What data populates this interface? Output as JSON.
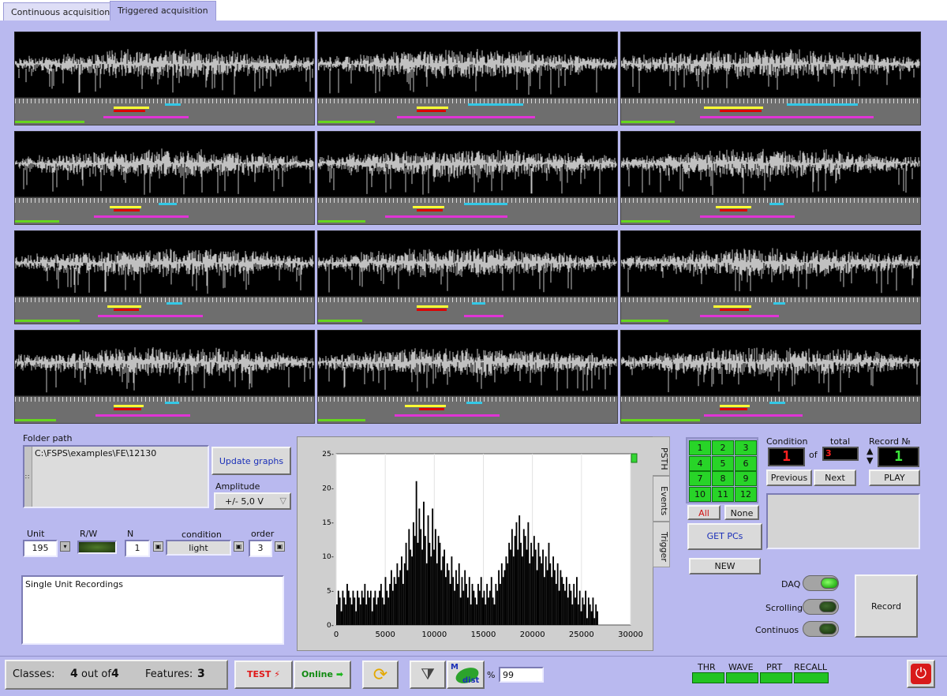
{
  "tabs": [
    {
      "label": "Continuous acquisition",
      "active": false
    },
    {
      "label": "Triggered acquisition",
      "active": true
    }
  ],
  "folder": {
    "label": "Folder path",
    "path": "C:\\FSPS\\examples\\FE\\12130",
    "update_button": "Update graphs"
  },
  "amplitude": {
    "label": "Amplitude",
    "value": "+/- 5,0 V"
  },
  "unit": {
    "label": "Unit",
    "value": "195"
  },
  "rw": {
    "label": "R/W"
  },
  "n": {
    "label": "N",
    "value": "1"
  },
  "condition_field": {
    "label": "condition",
    "value": "light"
  },
  "order": {
    "label": "order",
    "value": "3"
  },
  "notes": {
    "text": "Single Unit Recordings"
  },
  "chart_tabs": [
    "PSTH",
    "Events",
    "Trigger"
  ],
  "chart_data": {
    "type": "bar",
    "xlim": [
      0,
      30000
    ],
    "ylim": [
      0,
      25
    ],
    "xticks": [
      "0",
      "5000",
      "10000",
      "15000",
      "20000",
      "25000",
      "30000"
    ],
    "yticks": [
      "0-",
      "5-",
      "10-",
      "15-",
      "20-",
      "25-"
    ],
    "grid": true,
    "bin_width": 150,
    "values": [
      3,
      5,
      4,
      2,
      5,
      4,
      3,
      6,
      5,
      4,
      3,
      5,
      4,
      2,
      5,
      4,
      3,
      5,
      4,
      6,
      3,
      5,
      4,
      5,
      2,
      4,
      5,
      3,
      4,
      5,
      6,
      4,
      3,
      7,
      5,
      4,
      6,
      8,
      5,
      7,
      6,
      9,
      7,
      8,
      10,
      6,
      9,
      12,
      8,
      14,
      11,
      10,
      15,
      13,
      21,
      12,
      17,
      14,
      11,
      18,
      13,
      9,
      16,
      12,
      10,
      17,
      11,
      14,
      9,
      13,
      12,
      8,
      10,
      11,
      7,
      9,
      8,
      6,
      10,
      7,
      5,
      8,
      6,
      9,
      4,
      7,
      5,
      8,
      6,
      4,
      7,
      3,
      6,
      5,
      4,
      3,
      6,
      5,
      7,
      4,
      5,
      3,
      6,
      4,
      5,
      7,
      4,
      3,
      6,
      5,
      8,
      6,
      9,
      7,
      8,
      10,
      9,
      12,
      11,
      14,
      10,
      13,
      15,
      11,
      16,
      12,
      10,
      14,
      13,
      11,
      15,
      9,
      12,
      10,
      13,
      11,
      8,
      12,
      10,
      9,
      11,
      7,
      10,
      8,
      12,
      9,
      7,
      10,
      8,
      6,
      9,
      5,
      8,
      7,
      6,
      5,
      7,
      4,
      6,
      5,
      3,
      6,
      4,
      7,
      3,
      5,
      2,
      4,
      3,
      5,
      1,
      4,
      3,
      2,
      4,
      1,
      3,
      2
    ]
  },
  "keypad": {
    "keys": [
      "1",
      "2",
      "3",
      "4",
      "5",
      "6",
      "7",
      "8",
      "9",
      "10",
      "11",
      "12"
    ],
    "all": "All",
    "none": "None"
  },
  "get_pcs": "GET PCs",
  "new_button": "NEW",
  "condition_panel": {
    "label": "Condition",
    "total_label": "total",
    "value": "1",
    "of": "of",
    "total": "3",
    "previous": "Previous",
    "next": "Next"
  },
  "record_panel": {
    "label": "Record №",
    "value": "1",
    "play": "PLAY"
  },
  "switches": [
    {
      "label": "DAQ",
      "on": true
    },
    {
      "label": "Scrolling",
      "on": false
    },
    {
      "label": "Continuos",
      "on": false
    }
  ],
  "record_button": "Record",
  "status": {
    "classes_label": "Classes:",
    "classes_value": "4",
    "out_of": "out of",
    "classes_total": "4",
    "features_label": "Features:",
    "features_value": "3",
    "test": "TEST",
    "online": "Online",
    "mdist_m": "M",
    "mdist_dist": "dist",
    "percent_sign": "%",
    "percent_value": "99",
    "indicators": [
      "THR",
      "WAVE",
      "PRT",
      "RECALL"
    ]
  },
  "colors": {
    "background": "#b9b9ef",
    "accent_green": "#22c322",
    "event_yellow": "#ffff33",
    "event_red": "#dd0000",
    "event_cyan": "#33c8e6",
    "event_magenta": "#e034d6",
    "event_green": "#66d61e"
  }
}
